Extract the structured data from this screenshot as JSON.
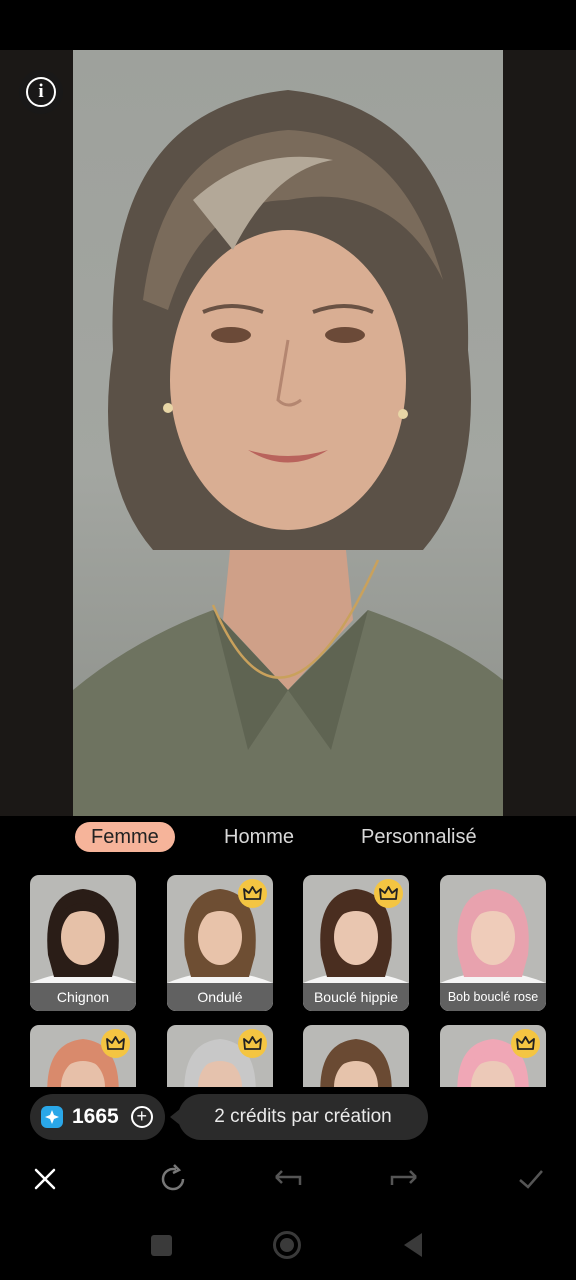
{
  "app": {
    "tabs": [
      {
        "label": "Femme",
        "active": true
      },
      {
        "label": "Homme",
        "active": false
      },
      {
        "label": "Personnalisé",
        "active": false
      }
    ],
    "styles": [
      {
        "label": "Chignon",
        "premium": false,
        "hair": "#2a1d17",
        "skin": "#e6c1a8"
      },
      {
        "label": "Ondulé",
        "premium": true,
        "hair": "#6e4e33",
        "skin": "#e8c3aa"
      },
      {
        "label": "Bouclé hippie",
        "premium": true,
        "hair": "#4a2e20",
        "skin": "#e9c6b0"
      },
      {
        "label": "Bob bouclé rose",
        "premium": false,
        "hair": "#e8a2ae",
        "skin": "#efccba"
      },
      {
        "label": "",
        "premium": true,
        "hair": "#d98a6c",
        "skin": "#e7c0a9"
      },
      {
        "label": "",
        "premium": true,
        "hair": "#c8c8c8",
        "skin": "#e5c2ad"
      },
      {
        "label": "",
        "premium": false,
        "hair": "#6a4a33",
        "skin": "#e6c3ab"
      },
      {
        "label": "",
        "premium": true,
        "hair": "#f0a7b6",
        "skin": "#ecc9b8"
      }
    ],
    "credits": {
      "count": "1665",
      "icon": "gem-icon"
    },
    "tooltip": "2 crédits par création",
    "toolbar": [
      "close-icon",
      "regenerate-icon",
      "undo-icon",
      "redo-icon",
      "confirm-icon"
    ],
    "colors": {
      "accent": "#f6b49a",
      "crown": "#f4c542",
      "gem": "#2aa7e8"
    }
  }
}
